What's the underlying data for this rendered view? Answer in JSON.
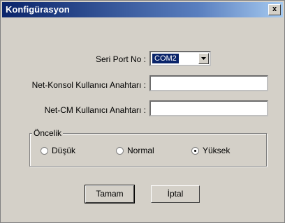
{
  "window": {
    "title": "Konfigürasyon",
    "close_label": "x"
  },
  "serial_port": {
    "label": "Seri Port No :",
    "value": "COM2"
  },
  "net_console_key": {
    "label": "Net-Konsol Kullanıcı Anahtarı :",
    "value": ""
  },
  "net_cm_key": {
    "label": "Net-CM Kullanıcı Anahtarı :",
    "value": ""
  },
  "priority": {
    "legend": "Öncelik",
    "options": [
      {
        "label": "Düşük",
        "selected": false
      },
      {
        "label": "Normal",
        "selected": false
      },
      {
        "label": "Yüksek",
        "selected": true
      }
    ]
  },
  "buttons": {
    "ok_label": "Tamam",
    "cancel_label": "İptal"
  }
}
